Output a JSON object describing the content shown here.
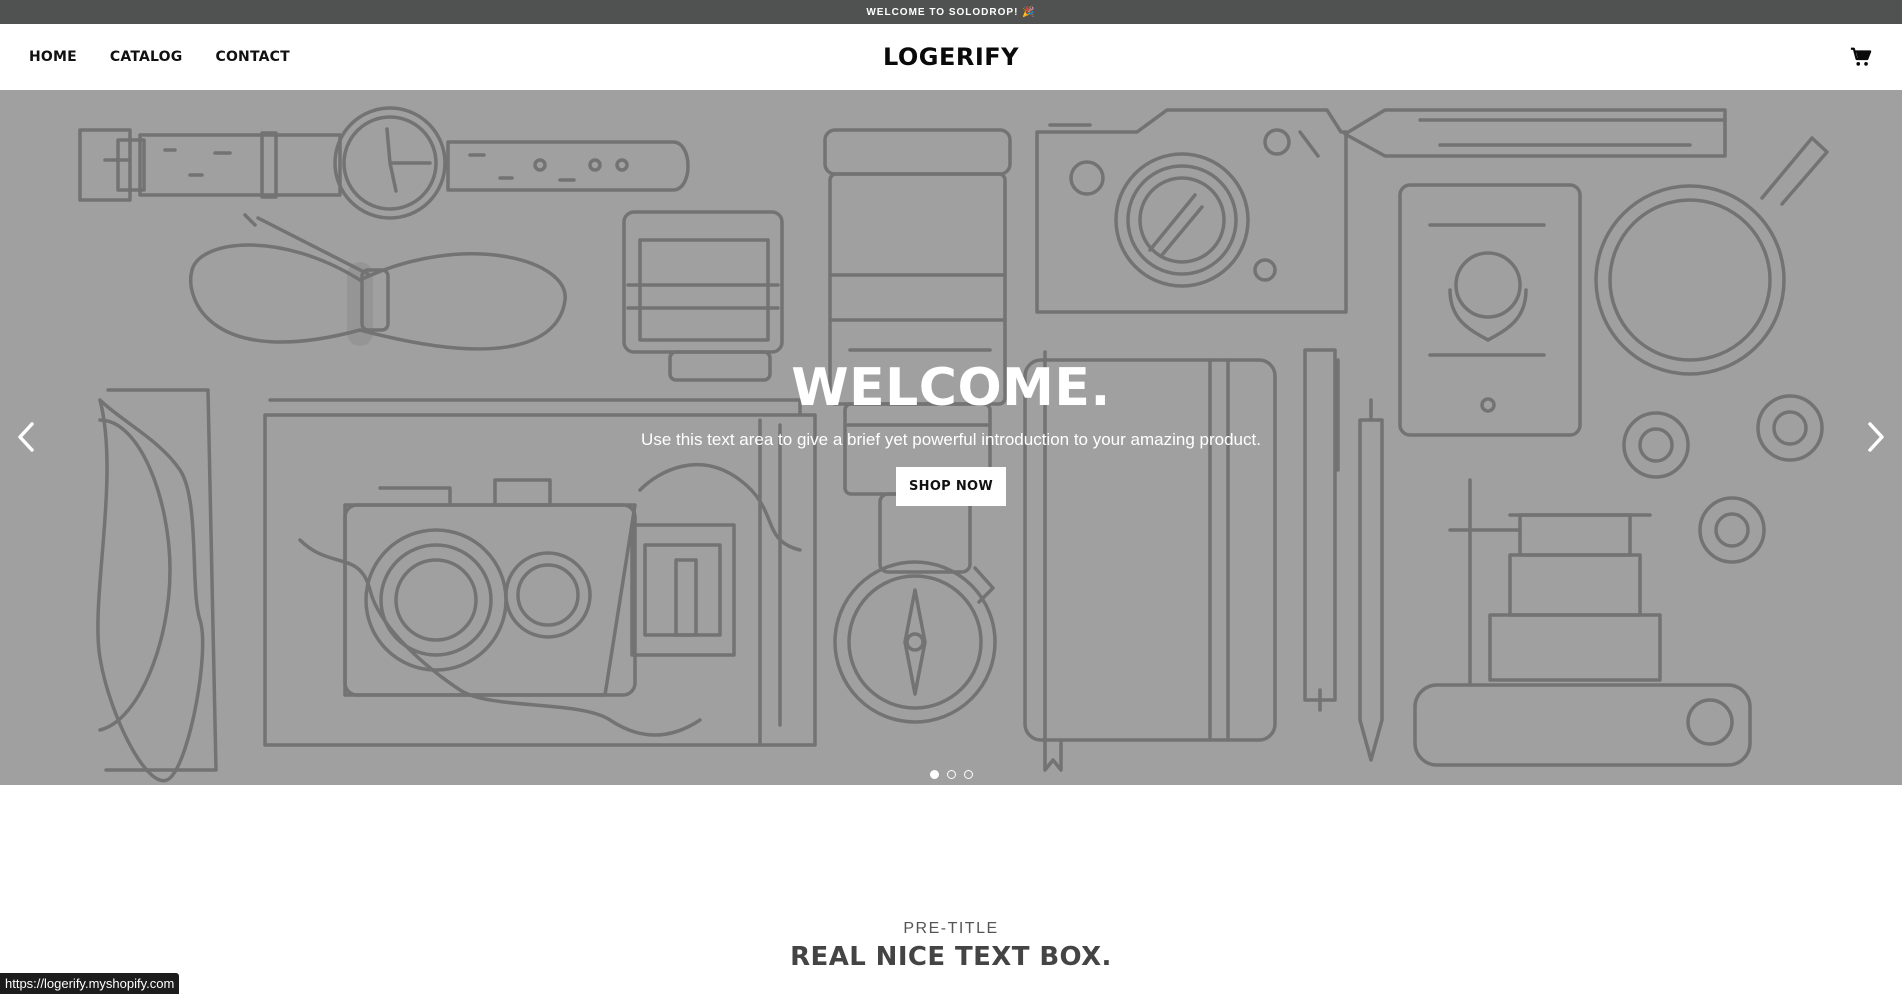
{
  "announcement": "WELCOME TO SOLODROP! 🎉",
  "header": {
    "nav": [
      {
        "label": "HOME"
      },
      {
        "label": "CATALOG"
      },
      {
        "label": "CONTACT"
      }
    ],
    "logo": "LOGERIFY",
    "cart_icon": "shopping-cart-icon"
  },
  "hero": {
    "title": "WELCOME.",
    "subtitle": "Use this text area to give a brief yet powerful introduction to your amazing product.",
    "button_label": "SHOP NOW",
    "background_color": "#a0a0a0",
    "line_art_color": "#737373",
    "prev_icon": "chevron-left-icon",
    "next_icon": "chevron-right-icon",
    "slide_count": 3,
    "active_slide": 1
  },
  "textbox": {
    "pretitle": "PRE-TITLE",
    "title": "REAL NICE TEXT BOX."
  },
  "status_bar": {
    "url": "https://logerify.myshopify.com"
  }
}
